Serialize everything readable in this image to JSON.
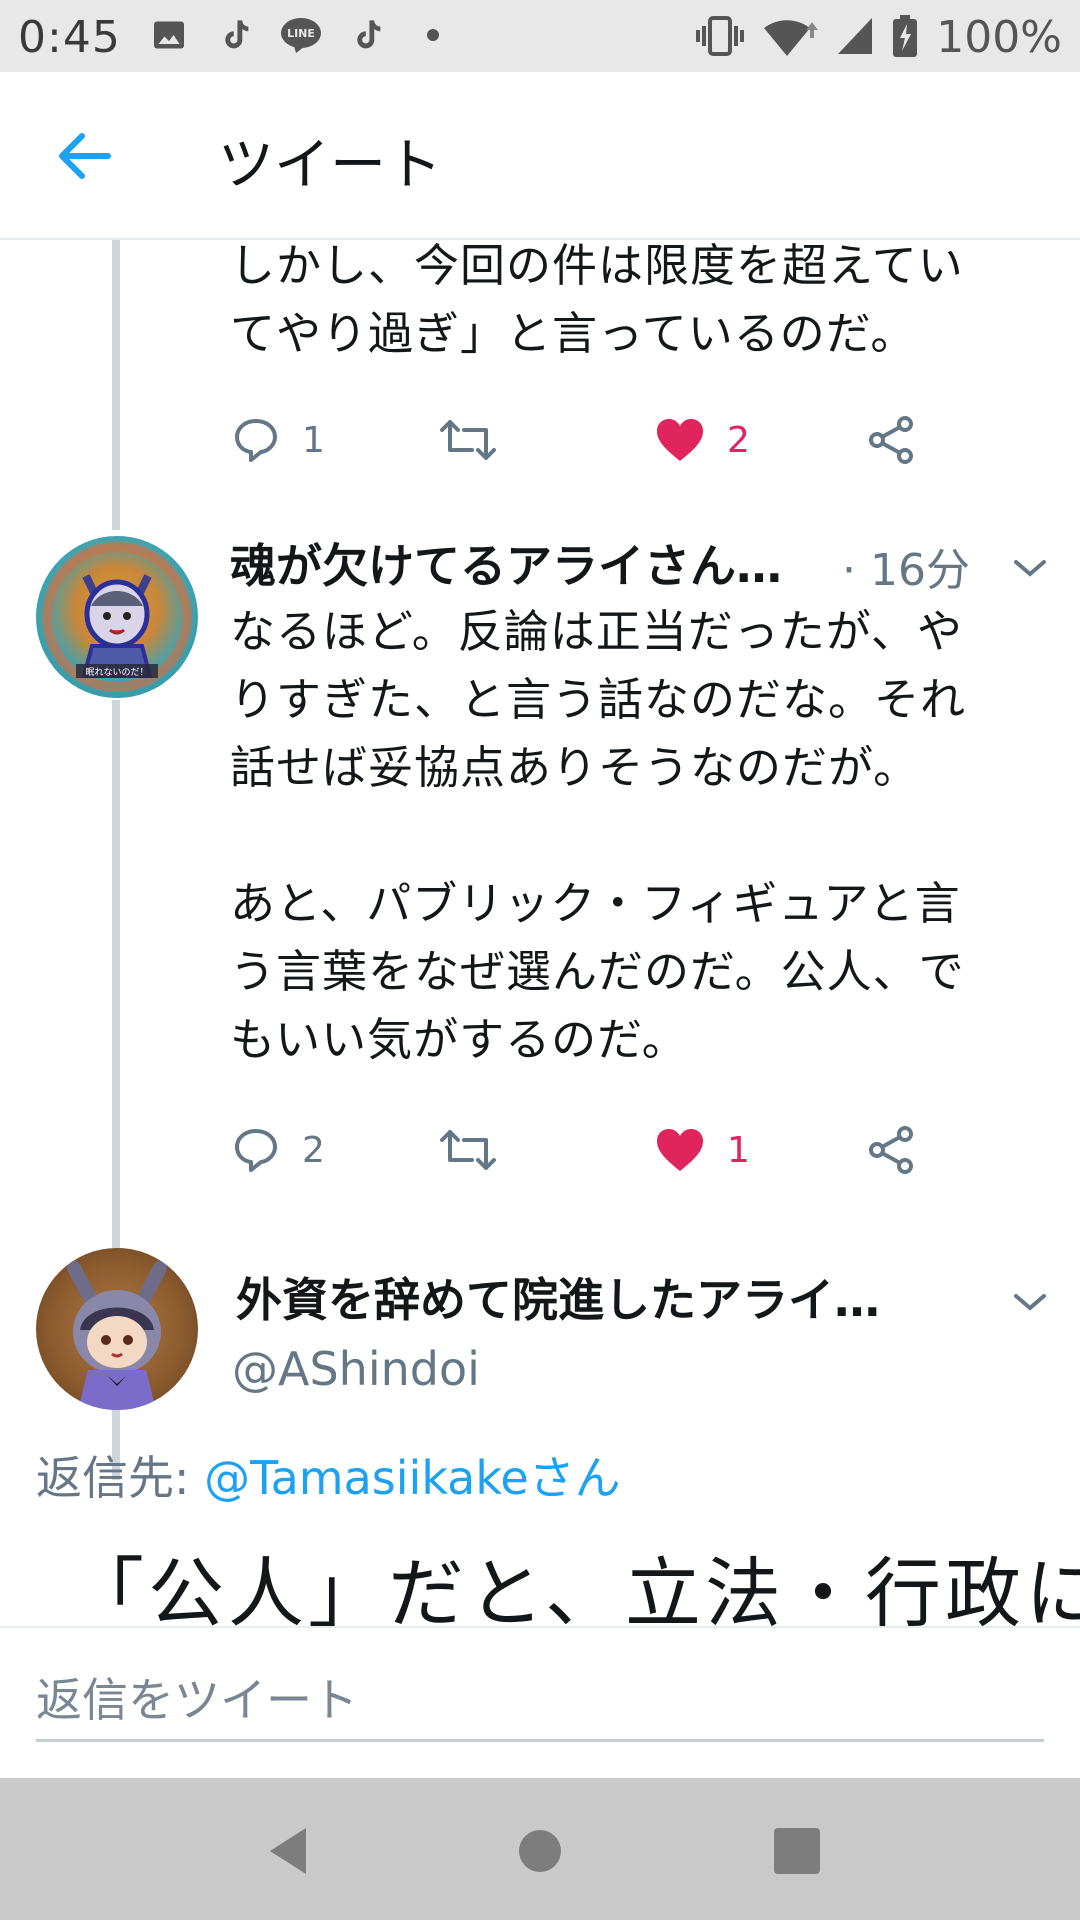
{
  "status_bar": {
    "time": "0:45",
    "battery": "100%",
    "left_icons": [
      "image-icon",
      "tiktok-icon",
      "line-icon",
      "tiktok-icon",
      "dot-icon"
    ],
    "right_icons": [
      "vibrate-icon",
      "wifi-icon",
      "signal-icon",
      "battery-charging-icon"
    ]
  },
  "header": {
    "title": "ツイート",
    "accent": "#1da1f2"
  },
  "tweets": [
    {
      "text_lines": [
        "しかし、今回の件は限度を超えてい",
        "てやり過ぎ」と言っているのだ。"
      ],
      "replies": "1",
      "likes": "2",
      "liked": true
    },
    {
      "display_name": "魂が欠けてるアライさん…",
      "time": "· 16分",
      "avatar_caption": "眠れないのだ！",
      "text_lines": [
        "なるほど。反論は正当だったが、や",
        "りすぎた、と言う話なのだな。それ",
        "話せば妥協点ありそうなのだが。",
        "",
        "あと、パブリック・フィギュアと言",
        "う言葉をなぜ選んだのだ。公人、で",
        "もいい気がするのだ。"
      ],
      "replies": "2",
      "likes": "1",
      "liked": true
    }
  ],
  "focused_tweet": {
    "display_name": "外資を辞めて院進したアライ…",
    "handle": "@AShindoi",
    "replying_label": "返信先:",
    "replying_to": "@Tamasiikakeさん",
    "text": "「公人」だと、立法・行政に"
  },
  "reply_bar": {
    "placeholder": "返信をツイート"
  },
  "colors": {
    "like": "#e0245e",
    "icon_gray": "#657786",
    "thread_line": "#ccd6dd"
  }
}
